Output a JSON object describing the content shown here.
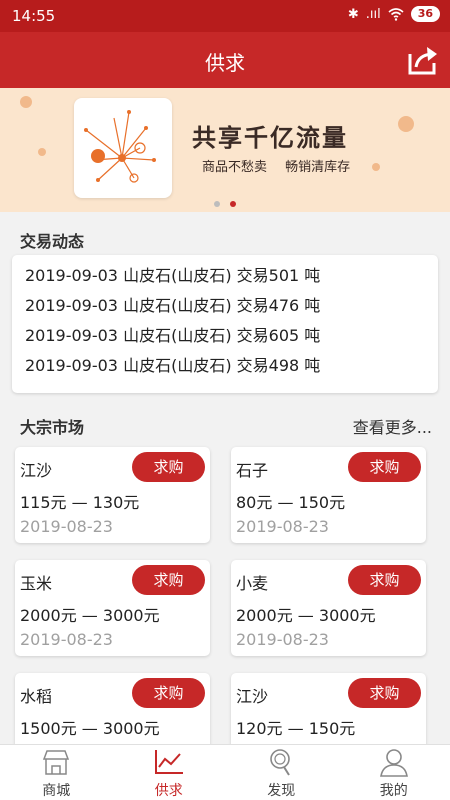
{
  "status_bar": {
    "time": "14:55",
    "battery": "36",
    "signal": ".ııl"
  },
  "header": {
    "title": "供求"
  },
  "banner": {
    "headline": "共享千亿流量",
    "sub1": "商品不愁卖",
    "sub2": "畅销清库存"
  },
  "trade": {
    "title": "交易动态",
    "rows": [
      "2019-09-03 山皮石(山皮石) 交易501 吨",
      "2019-09-03 山皮石(山皮石) 交易476 吨",
      "2019-09-03 山皮石(山皮石) 交易605 吨",
      "2019-09-03 山皮石(山皮石) 交易498 吨"
    ]
  },
  "market": {
    "title": "大宗市场",
    "more": "查看更多...",
    "items": [
      {
        "name": "江沙",
        "action": "求购",
        "price": "115元 — 130元",
        "date": "2019-08-23"
      },
      {
        "name": "石子",
        "action": "求购",
        "price": "80元 — 150元",
        "date": "2019-08-23"
      },
      {
        "name": "玉米",
        "action": "求购",
        "price": "2000元 — 3000元",
        "date": "2019-08-23"
      },
      {
        "name": "小麦",
        "action": "求购",
        "price": "2000元 — 3000元",
        "date": "2019-08-23"
      },
      {
        "name": "水稻",
        "action": "求购",
        "price": "1500元 — 3000元",
        "date": ""
      },
      {
        "name": "江沙",
        "action": "求购",
        "price": "120元 — 150元",
        "date": ""
      }
    ]
  },
  "tabs": [
    {
      "label": "商城",
      "icon": "store-icon"
    },
    {
      "label": "供求",
      "icon": "trend-icon"
    },
    {
      "label": "发现",
      "icon": "search-icon"
    },
    {
      "label": "我的",
      "icon": "user-icon"
    }
  ],
  "colors": {
    "primary": "#c62828",
    "banner_bg": "#fbe5cd"
  }
}
